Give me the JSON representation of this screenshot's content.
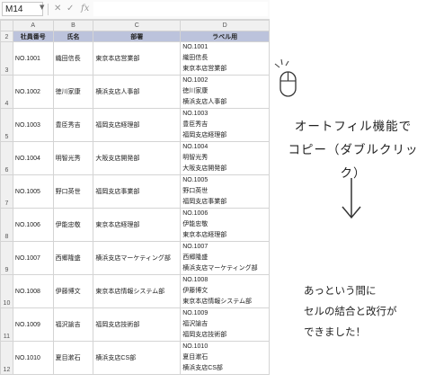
{
  "name_box": "M14",
  "formula_bar": {
    "cancel_icon": "✕",
    "enter_icon": "✓",
    "function_icon": "fx",
    "content": ""
  },
  "columns": [
    "A",
    "B",
    "C",
    "D"
  ],
  "row_numbers": [
    "2",
    "3",
    "4",
    "5",
    "6",
    "7",
    "8",
    "9",
    "10",
    "11",
    "12"
  ],
  "table": {
    "headers": [
      "社員番号",
      "氏名",
      "部署",
      "ラベル用"
    ],
    "rows": [
      {
        "id": "NO.1001",
        "name": "織田信長",
        "dept": "東京本店営業部",
        "label": [
          "NO.1001",
          "織田信長",
          "東京本店営業部"
        ]
      },
      {
        "id": "NO.1002",
        "name": "徳川家康",
        "dept": "横浜支店人事部",
        "label": [
          "NO.1002",
          "徳川家康",
          "横浜支店人事部"
        ]
      },
      {
        "id": "NO.1003",
        "name": "豊臣秀吉",
        "dept": "福岡支店経理部",
        "label": [
          "NO.1003",
          "豊臣秀吉",
          "福岡支店経理部"
        ]
      },
      {
        "id": "NO.1004",
        "name": "明智光秀",
        "dept": "大阪支店開発部",
        "label": [
          "NO.1004",
          "明智光秀",
          "大阪支店開発部"
        ]
      },
      {
        "id": "NO.1005",
        "name": "野口英世",
        "dept": "福岡支店事業部",
        "label": [
          "NO.1005",
          "野口英世",
          "福岡支店事業部"
        ]
      },
      {
        "id": "NO.1006",
        "name": "伊能忠敬",
        "dept": "東京本店経理部",
        "label": [
          "NO.1006",
          "伊能忠敬",
          "東京本店経理部"
        ]
      },
      {
        "id": "NO.1007",
        "name": "西郷隆盛",
        "dept": "横浜支店マーケティング部",
        "label": [
          "NO.1007",
          "西郷隆盛",
          "横浜支店マーケティング部"
        ]
      },
      {
        "id": "NO.1008",
        "name": "伊藤博文",
        "dept": "東京本店情報システム部",
        "label": [
          "NO.1008",
          "伊藤博文",
          "東京本店情報システム部"
        ]
      },
      {
        "id": "NO.1009",
        "name": "福沢諭吉",
        "dept": "福岡支店技術部",
        "label": [
          "NO.1009",
          "福沢諭吉",
          "福岡支店技術部"
        ]
      },
      {
        "id": "NO.1010",
        "name": "夏目漱石",
        "dept": "横浜支店CS部",
        "label": [
          "NO.1010",
          "夏目漱石",
          "横浜支店CS部"
        ]
      }
    ]
  },
  "annotations": {
    "title_lines": [
      "オートフィル機能で",
      "コピー（ダブルクリック）"
    ],
    "note_lines": [
      "あっという間に",
      "セルの結合と改行が",
      "できました！"
    ],
    "mouse_icon": "mouse-click-icon",
    "arrow_icon": "down-arrow-icon"
  },
  "colors": {
    "header_fill": "#bcc3dc",
    "grid_line": "#d4d4d4",
    "heading_fill": "#f0f0f0"
  }
}
